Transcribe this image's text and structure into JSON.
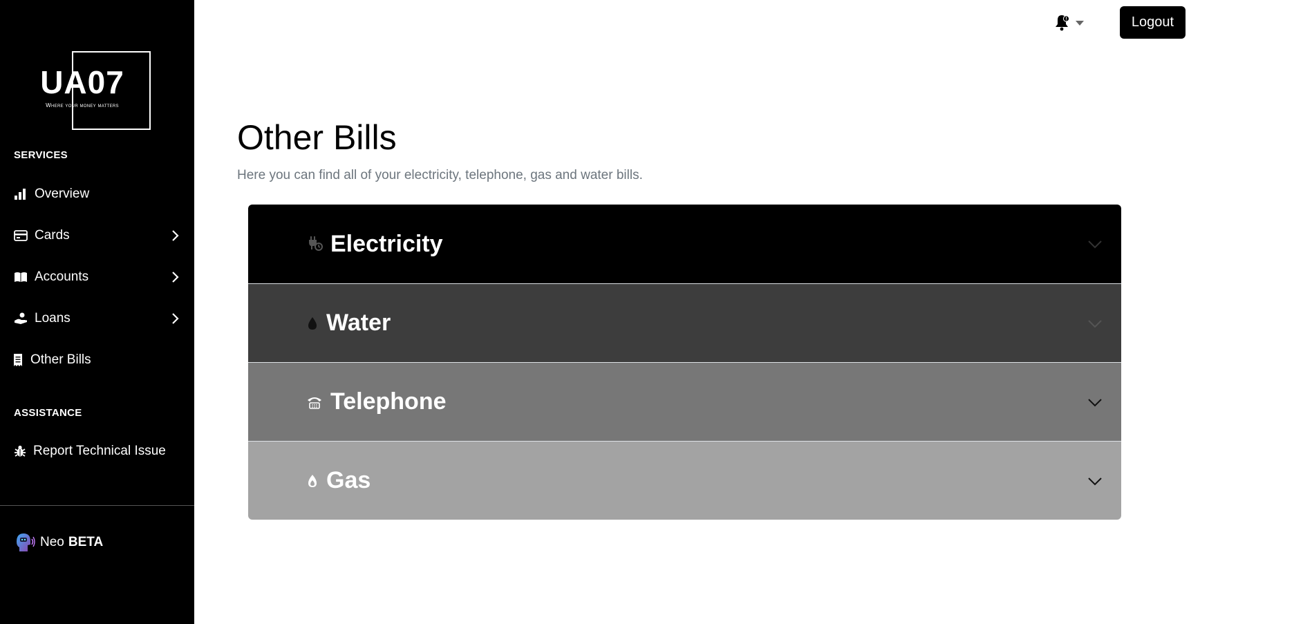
{
  "brand": {
    "name": "UA07",
    "tagline": "Where your money matters"
  },
  "sidebar": {
    "services_label": "SERVICES",
    "items": [
      {
        "label": "Overview",
        "icon": "bar-chart-icon"
      },
      {
        "label": "Cards",
        "icon": "credit-card-icon"
      },
      {
        "label": "Accounts",
        "icon": "book-icon"
      },
      {
        "label": "Loans",
        "icon": "hand-coin-icon"
      },
      {
        "label": "Other Bills",
        "icon": "receipt-icon"
      }
    ],
    "assistance_label": "ASSISTANCE",
    "assistance_items": [
      {
        "label": "Report Technical Issue",
        "icon": "bug-icon"
      }
    ],
    "neo": {
      "name": "Neo",
      "badge": "BETA"
    }
  },
  "header": {
    "logout_label": "Logout"
  },
  "main": {
    "title": "Other Bills",
    "subtitle": "Here you can find all of your electricity, telephone, gas and water bills."
  },
  "accordion": [
    {
      "label": "Electricity",
      "icon": "plug-icon",
      "bg": "#000000"
    },
    {
      "label": "Water",
      "icon": "droplet-icon",
      "bg": "#3d3d3d"
    },
    {
      "label": "Telephone",
      "icon": "telephone-icon",
      "bg": "#777777"
    },
    {
      "label": "Gas",
      "icon": "flame-icon",
      "bg": "#a3a3a3"
    }
  ]
}
